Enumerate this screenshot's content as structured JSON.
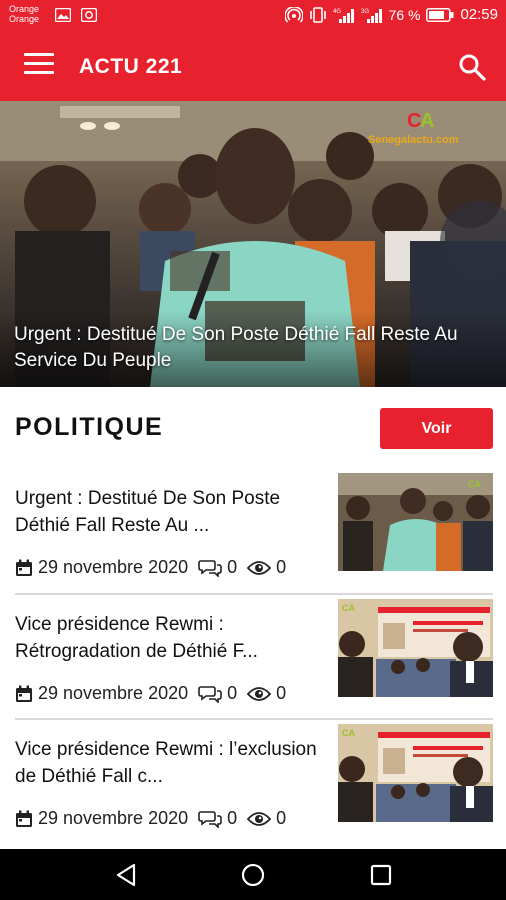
{
  "status_bar": {
    "carrier_line1": "Orange",
    "carrier_line2": "Orange",
    "battery_percent": "76 %",
    "time": "02:59",
    "icons": [
      "image-icon",
      "camera-icon",
      "hotspot-icon",
      "vibrate-icon",
      "signal-4g-icon",
      "signal-3g-icon",
      "battery-icon"
    ]
  },
  "app_bar": {
    "title": "ACTU 221",
    "menu_icon": "hamburger-menu-icon",
    "search_icon": "search-icon"
  },
  "hero": {
    "caption": "Urgent : Destitué De Son Poste Déthié Fall Reste Au Service Du Peuple",
    "watermark": "Senegalactu.com"
  },
  "section": {
    "title": "POLITIQUE",
    "button_label": "Voir"
  },
  "articles": [
    {
      "title": "Urgent : Destitué De Son Poste Déthié Fall Reste Au ...",
      "date": "29 novembre 2020",
      "comments": "0",
      "views": "0"
    },
    {
      "title": "Vice présidence Rewmi : Rétrogradation de Déthié F...",
      "date": "29 novembre 2020",
      "comments": "0",
      "views": "0"
    },
    {
      "title": "Vice présidence Rewmi : l’exclusion de Déthié Fall c...",
      "date": "29 novembre 2020",
      "comments": "0",
      "views": "0"
    }
  ],
  "nav_bar": {
    "buttons": [
      "back-icon",
      "home-icon",
      "recents-icon"
    ]
  },
  "colors": {
    "accent": "#e8212e",
    "nav": "#000000"
  }
}
